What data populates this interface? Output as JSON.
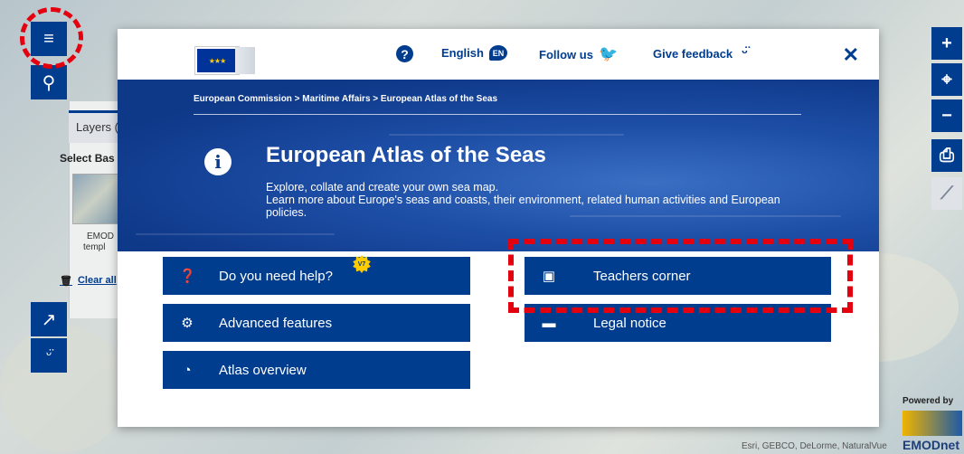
{
  "left_toolbar": {
    "layers_tab_label": "Layers (",
    "select_base_label": "Select Bas",
    "emod_caption_1": "EMOD",
    "emod_caption_2": "templ",
    "clear_all_label": "Clear all"
  },
  "modal": {
    "top_bar": {
      "language": "English",
      "language_code": "EN",
      "follow_us": "Follow us",
      "give_feedback": "Give feedback",
      "close_glyph": "✕"
    },
    "hero": {
      "breadcrumb": "European Commission > Maritime Affairs > European Atlas of the Seas",
      "title": "European Atlas of the Seas",
      "description_line1": "Explore, collate and create your own sea map.",
      "description_line2": "Learn more about Europe's seas and coasts, their environment, related human activities and European policies."
    },
    "menu_left": [
      {
        "label": "Do you need help?",
        "icon": "question-circle-icon"
      },
      {
        "label": "Advanced features",
        "icon": "gear-icon"
      },
      {
        "label": "Atlas overview",
        "icon": "compass-icon"
      }
    ],
    "menu_right": [
      {
        "label": "Teachers corner",
        "icon": "teacher-board-icon"
      },
      {
        "label": "Legal notice",
        "icon": "speech-bubble-icon"
      }
    ],
    "help_badge": "V7"
  },
  "map": {
    "attribution": "Esri, GEBCO, DeLorme, NaturalVue",
    "powered_by": "Powered by",
    "emodnet_label": "EMODnet"
  },
  "colors": {
    "primary_blue": "#003d8f",
    "highlight_red": "#e3000f",
    "badge_yellow": "#ffcc00"
  }
}
